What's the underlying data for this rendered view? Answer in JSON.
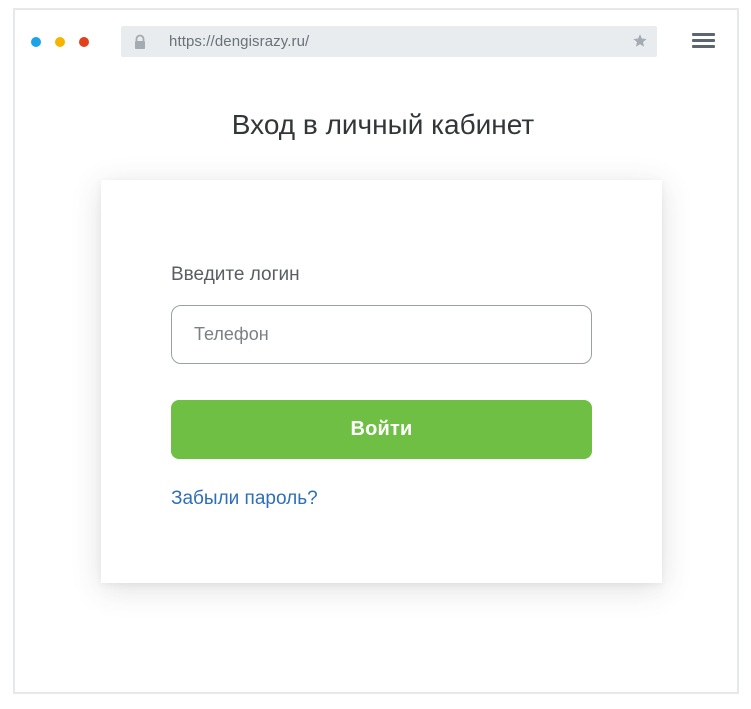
{
  "browser": {
    "url": "https://dengisrazy.ru/",
    "window_dots": [
      {
        "name": "blue",
        "color": "#1aa3e8"
      },
      {
        "name": "yellow",
        "color": "#f5b400"
      },
      {
        "name": "red",
        "color": "#e2401c"
      }
    ],
    "icons": {
      "lock": "lock-icon",
      "star": "star-icon",
      "menu": "hamburger-menu-icon"
    }
  },
  "page": {
    "title": "Вход в личный кабинет"
  },
  "login_form": {
    "field_label": "Введите логин",
    "phone_placeholder": "Телефон",
    "phone_value": "",
    "submit_label": "Войти",
    "forgot_link": "Забыли пароль?"
  },
  "colors": {
    "accent_button": "#6ebf43",
    "link": "#2e6fb7"
  }
}
